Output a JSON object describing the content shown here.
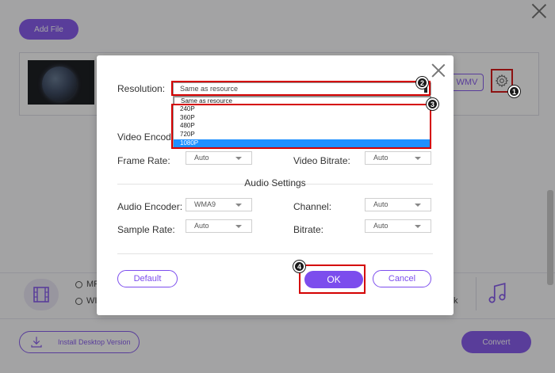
{
  "app": {
    "add_file_label": "Add File",
    "format_badge": "WMV",
    "format_options": [
      "MP",
      "WI"
    ],
    "partial_text_right": "k",
    "install_label": "Install Desktop Version",
    "convert_label": "Convert"
  },
  "dialog": {
    "resolution_label": "Resolution:",
    "resolution_value": "Same as resource",
    "resolution_options": [
      "Same as resource",
      "240P",
      "360P",
      "480P",
      "720P",
      "1080P"
    ],
    "resolution_highlighted": "1080P",
    "video_encoder_label": "Video Encode",
    "frame_rate_label": "Frame Rate:",
    "frame_rate_value": "Auto",
    "video_bitrate_label": "Video Bitrate:",
    "video_bitrate_value": "Auto",
    "audio_section_title": "Audio Settings",
    "audio_encoder_label": "Audio Encoder:",
    "audio_encoder_value": "WMA9",
    "channel_label": "Channel:",
    "channel_value": "Auto",
    "sample_rate_label": "Sample Rate:",
    "sample_rate_value": "Auto",
    "bitrate_label": "Bitrate:",
    "bitrate_value": "Auto",
    "default_label": "Default",
    "ok_label": "OK",
    "cancel_label": "Cancel"
  },
  "annotations": {
    "markers": [
      "1",
      "2",
      "3",
      "4"
    ],
    "highlight_color": "#d40000"
  },
  "colors": {
    "accent": "#7c4ded",
    "selection": "#1e90ff"
  }
}
